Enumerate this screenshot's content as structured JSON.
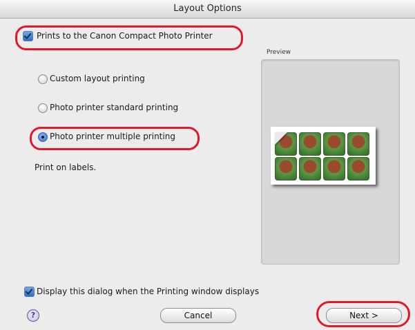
{
  "dialog": {
    "title": "Layout Options"
  },
  "printer_checkbox": {
    "label": "Prints to the Canon Compact Photo Printer",
    "checked": true
  },
  "layout_options": [
    {
      "label": "Custom layout printing",
      "selected": false
    },
    {
      "label": "Photo printer standard printing",
      "selected": false
    },
    {
      "label": "Photo printer multiple printing",
      "selected": true
    }
  ],
  "description": "Print on labels.",
  "preview": {
    "label": "Preview"
  },
  "display_checkbox": {
    "label": "Display this dialog when the Printing window displays",
    "checked": true
  },
  "buttons": {
    "help": "?",
    "cancel": "Cancel",
    "next": "Next >"
  },
  "colors": {
    "highlight": "#e3162c",
    "accent": "#2f6fc8"
  }
}
